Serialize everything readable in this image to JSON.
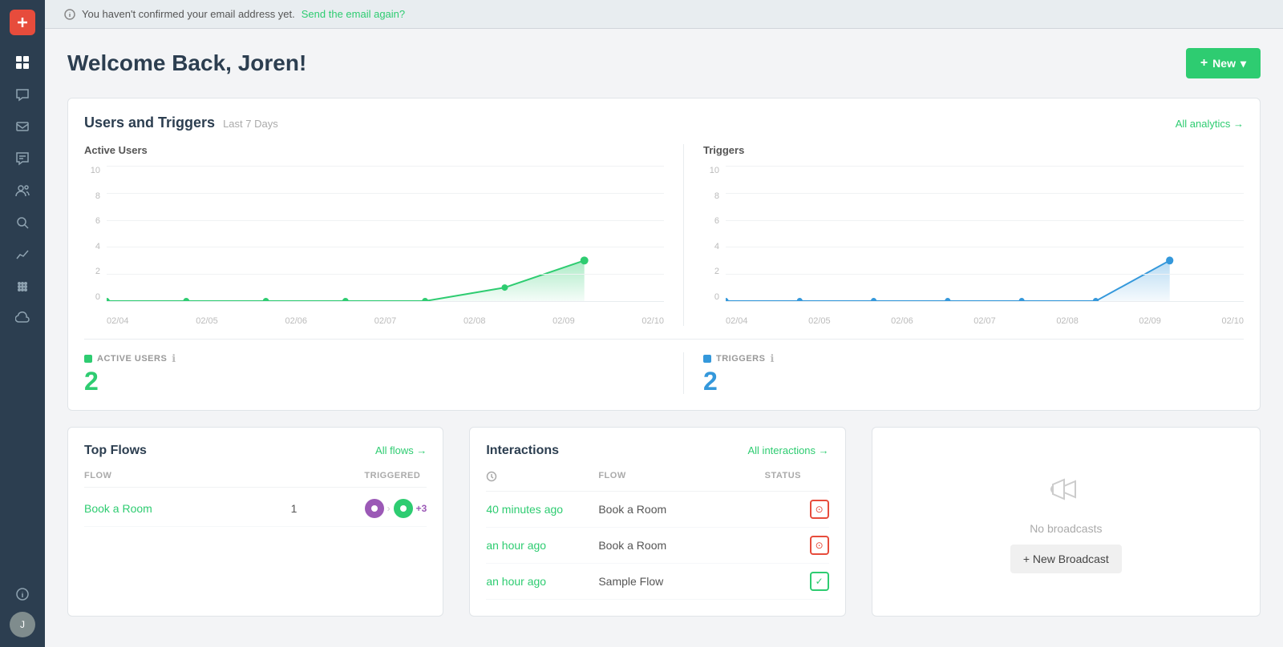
{
  "sidebar": {
    "logo": "✕",
    "icons": [
      {
        "name": "dashboard-icon",
        "symbol": "⊞",
        "active": true
      },
      {
        "name": "chat-icon",
        "symbol": "💬",
        "active": false
      },
      {
        "name": "message-icon",
        "symbol": "✉",
        "active": false
      },
      {
        "name": "comment-icon",
        "symbol": "🗨",
        "active": false
      },
      {
        "name": "users-icon",
        "symbol": "👤",
        "active": false
      },
      {
        "name": "search-icon",
        "symbol": "🔍",
        "active": false
      },
      {
        "name": "analytics-icon",
        "symbol": "📈",
        "active": false
      },
      {
        "name": "apps-icon",
        "symbol": "⊞",
        "active": false
      },
      {
        "name": "cloud-icon",
        "symbol": "☁",
        "active": false
      }
    ],
    "bottom_icons": [
      {
        "name": "info-icon",
        "symbol": "ℹ"
      },
      {
        "name": "avatar",
        "symbol": "J"
      }
    ]
  },
  "banner": {
    "icon": "ℹ",
    "text": "You haven't confirmed your email address yet.",
    "link_text": "Send the email again?"
  },
  "header": {
    "title": "Welcome Back, Joren!",
    "new_button": "New"
  },
  "analytics": {
    "section_title": "Users and Triggers",
    "section_subtitle": "Last 7 Days",
    "link": "All analytics →",
    "active_users": {
      "label": "Active Users",
      "stat_label": "ACTIVE USERS",
      "value": "2",
      "dates": [
        "02/04",
        "02/05",
        "02/06",
        "02/07",
        "02/08",
        "02/09",
        "02/10"
      ],
      "y_labels": [
        "10",
        "8",
        "6",
        "4",
        "2",
        "0"
      ],
      "data_points": [
        0,
        0,
        0,
        0,
        0,
        1,
        3
      ],
      "color": "#2ecc71"
    },
    "triggers": {
      "label": "Triggers",
      "stat_label": "TRIGGERS",
      "value": "2",
      "dates": [
        "02/04",
        "02/05",
        "02/06",
        "02/07",
        "02/08",
        "02/09",
        "02/10"
      ],
      "y_labels": [
        "10",
        "8",
        "6",
        "4",
        "2",
        "0"
      ],
      "data_points": [
        0,
        0,
        0,
        0,
        0,
        0,
        3
      ],
      "color": "#3498db"
    }
  },
  "top_flows": {
    "title": "Top Flows",
    "link": "All flows →",
    "col_flow": "FLOW",
    "col_triggered": "TRIGGERED",
    "rows": [
      {
        "name": "Book a Room",
        "triggered": "1",
        "icons": [
          "purple",
          "purple"
        ],
        "more": "+3"
      }
    ]
  },
  "interactions": {
    "title": "Interactions",
    "link": "All interactions →",
    "col_time": "TIME",
    "col_flow": "FLOW",
    "col_status": "STATUS",
    "rows": [
      {
        "time": "40 minutes ago",
        "flow": "Book a Room",
        "status": "error"
      },
      {
        "time": "an hour ago",
        "flow": "Book a Room",
        "status": "error"
      },
      {
        "time": "an hour ago",
        "flow": "Sample Flow",
        "status": "success"
      }
    ]
  },
  "broadcasts": {
    "empty_text": "No broadcasts",
    "button": "+ New Broadcast"
  }
}
